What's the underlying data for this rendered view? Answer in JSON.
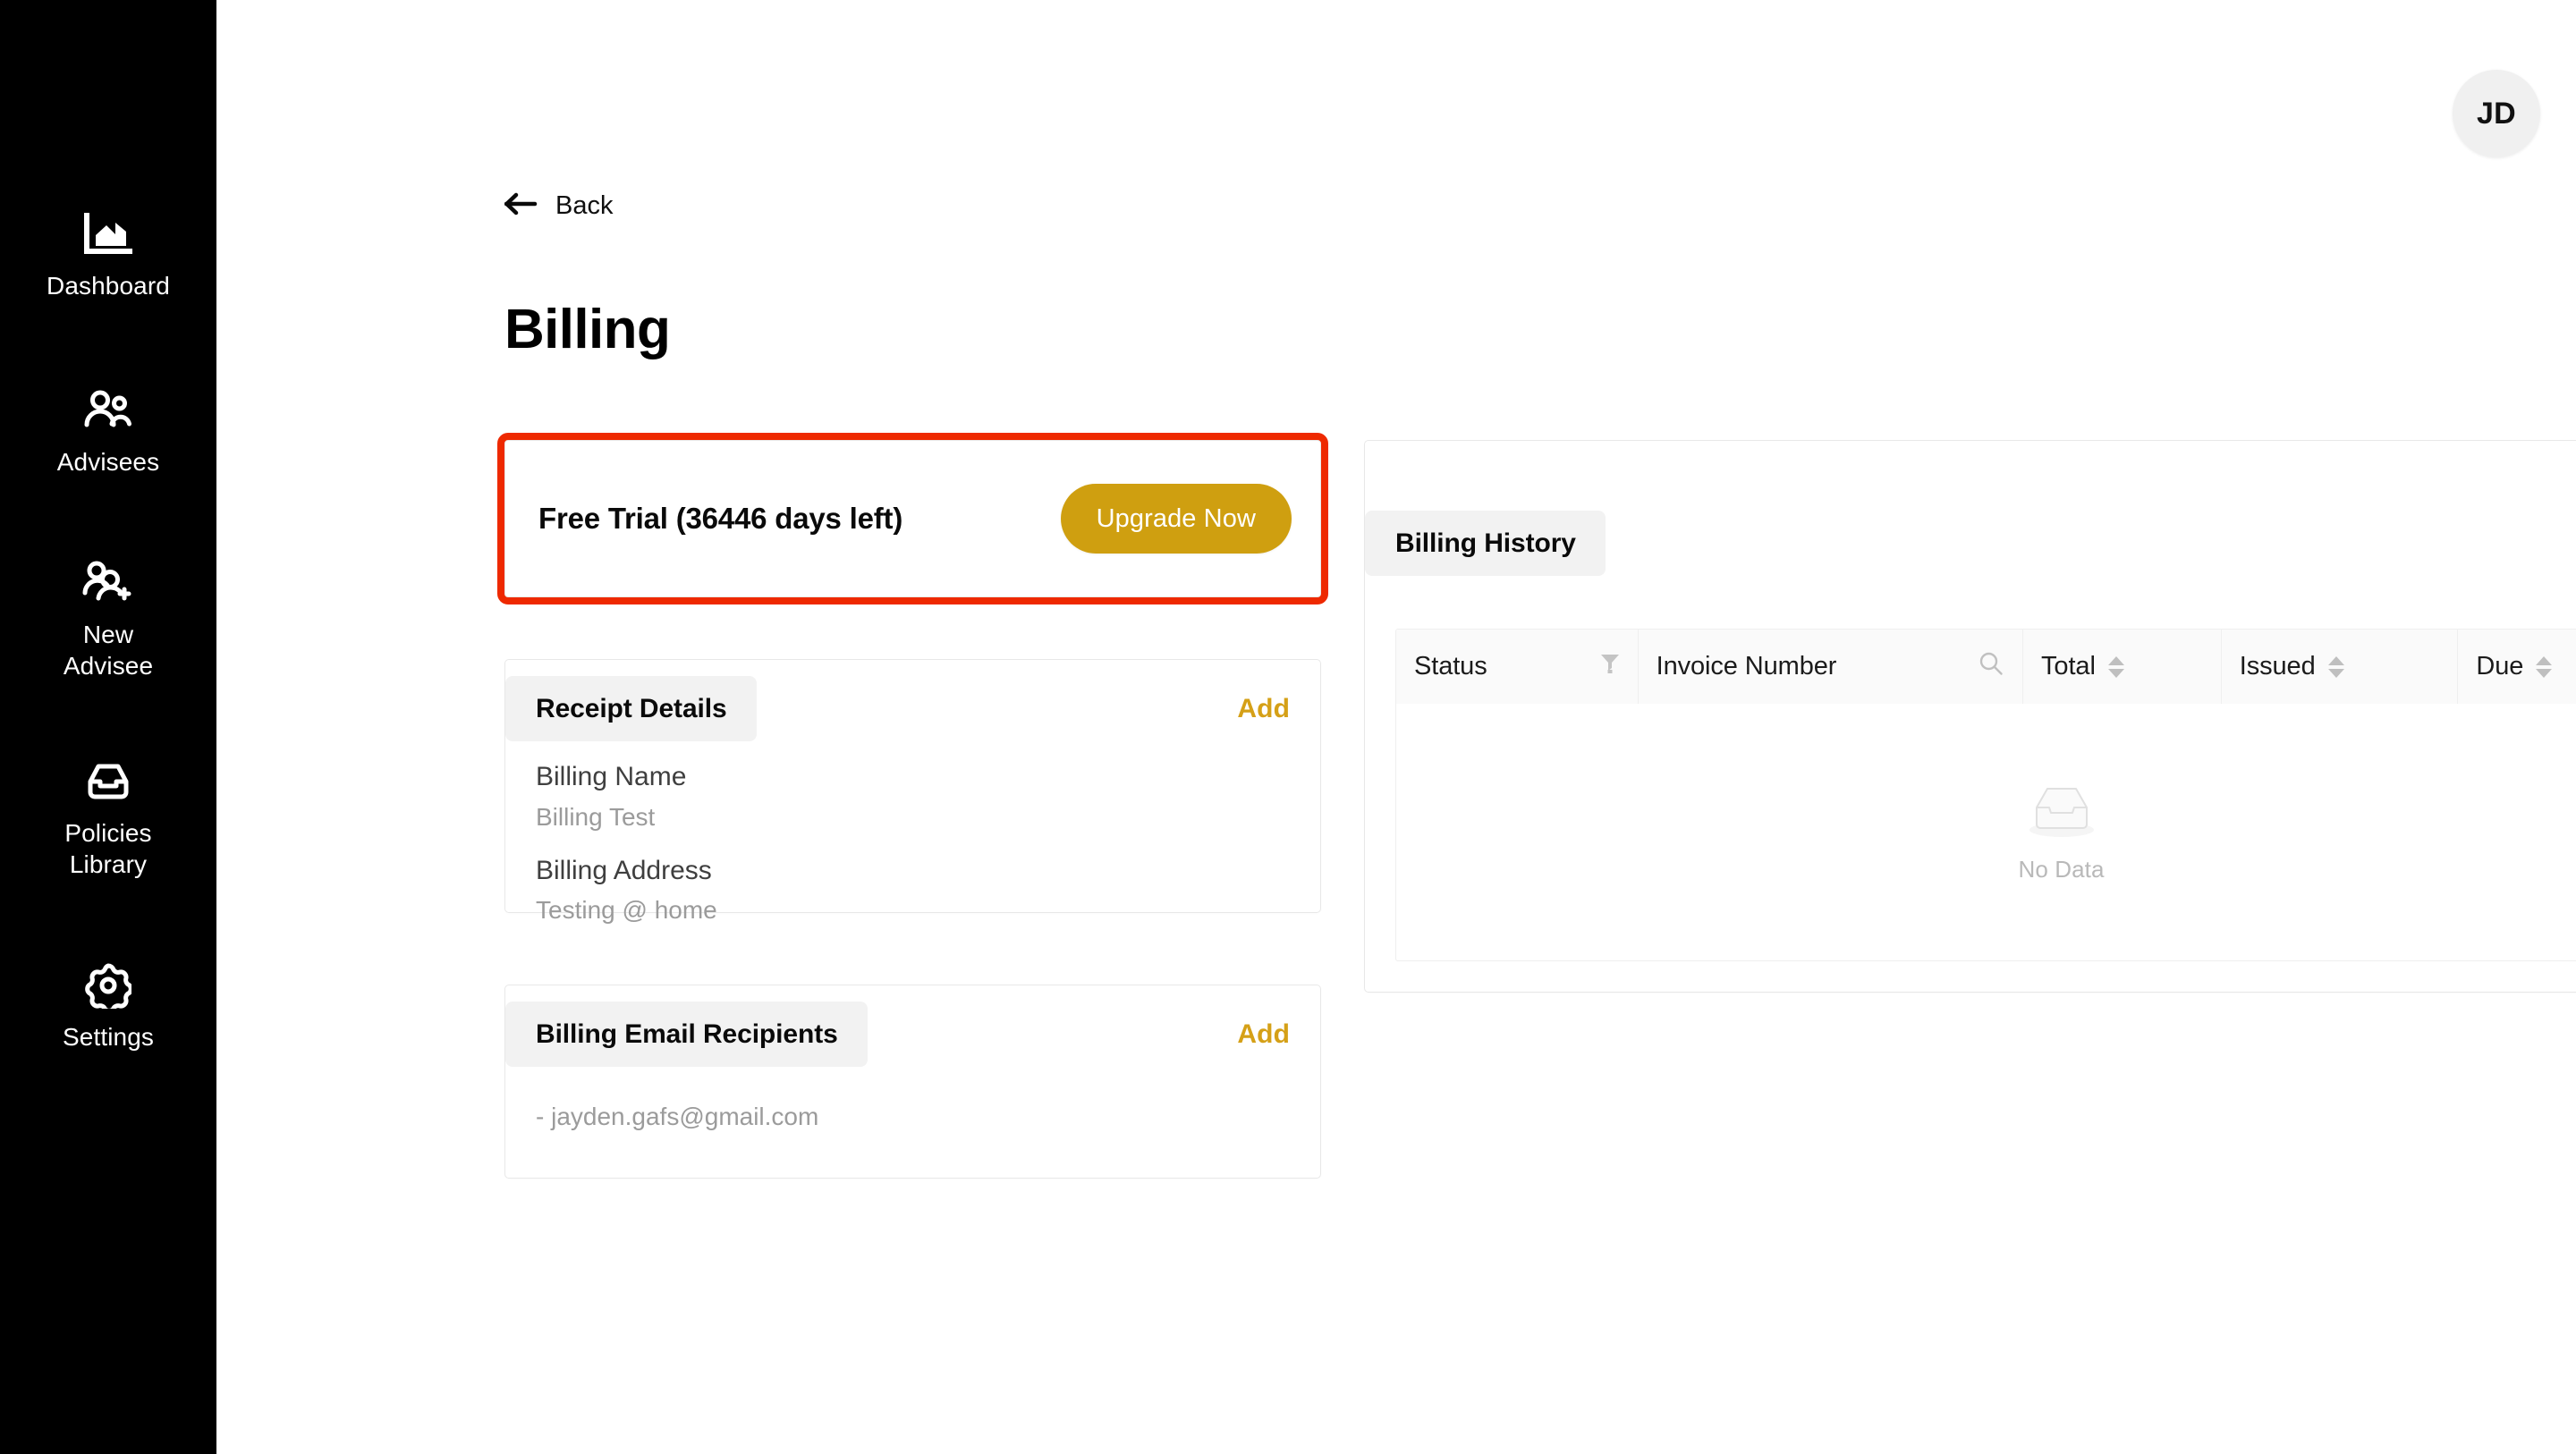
{
  "sidebar": {
    "background": "#000000",
    "items": [
      {
        "id": "dashboard",
        "label": "Dashboard",
        "icon": "dashboard-chart-icon"
      },
      {
        "id": "advisees",
        "label": "Advisees",
        "icon": "people-icon"
      },
      {
        "id": "new-advisee",
        "label": "New\nAdvisee",
        "icon": "person-add-icon"
      },
      {
        "id": "policies",
        "label": "Policies\nLibrary",
        "icon": "inbox-icon"
      },
      {
        "id": "settings",
        "label": "Settings",
        "icon": "gear-icon"
      }
    ]
  },
  "topbar": {
    "avatar_initials": "JD"
  },
  "header": {
    "back_label": "Back",
    "page_title": "Billing"
  },
  "trial": {
    "text": "Free Trial (36446 days left)",
    "upgrade_label": "Upgrade Now",
    "button_color": "#cf9f10",
    "highlight_color": "#ee2900"
  },
  "receipt_details": {
    "title": "Receipt Details",
    "add_label": "Add",
    "fields": [
      {
        "label": "Billing Name",
        "value": "Billing Test"
      },
      {
        "label": "Billing Address",
        "value": "Testing @ home"
      }
    ]
  },
  "billing_email_recipients": {
    "title": "Billing Email Recipients",
    "add_label": "Add",
    "recipients": [
      "- jayden.gafs@gmail.com"
    ]
  },
  "billing_history": {
    "title": "Billing History",
    "columns": [
      {
        "key": "status",
        "label": "Status",
        "control": "filter-icon"
      },
      {
        "key": "invoice",
        "label": "Invoice Number",
        "control": "search-icon"
      },
      {
        "key": "total",
        "label": "Total",
        "control": "sort-carets"
      },
      {
        "key": "issued",
        "label": "Issued",
        "control": "sort-carets"
      },
      {
        "key": "due",
        "label": "Due",
        "control": "sort-carets"
      }
    ],
    "rows": [],
    "empty_label": "No Data"
  },
  "colors": {
    "accent_gold": "#cf9f10",
    "add_link_gold": "#d5a017",
    "chip_gray": "#f2f2f2",
    "table_head_gray": "#fafafa",
    "border_gray": "#e8e8e8",
    "muted_text": "#9b9b9b"
  }
}
